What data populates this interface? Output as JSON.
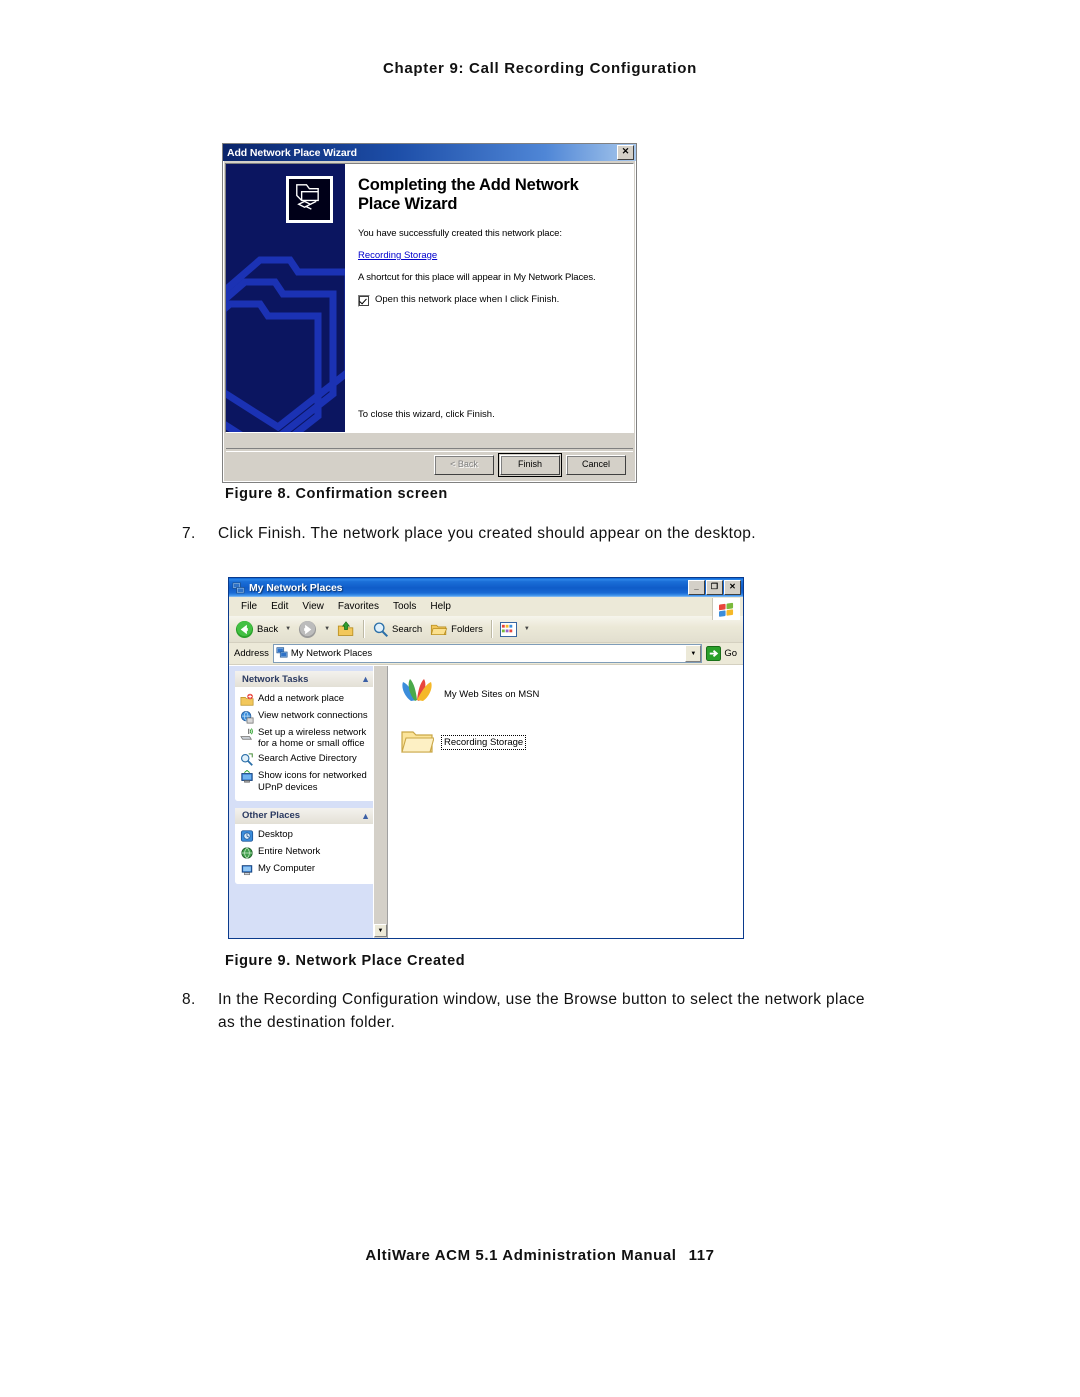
{
  "page": {
    "header": "Chapter 9:  Call Recording Configuration",
    "footer_text": "AltiWare ACM 5.1 Administration Manual",
    "footer_page": "117"
  },
  "figure8": {
    "caption": "Figure 8.   Confirmation screen"
  },
  "figure9": {
    "caption": "Figure 9.   Network Place Created"
  },
  "steps": [
    {
      "number": "7.",
      "text": "Click Finish. The network place you created should appear on the desktop."
    },
    {
      "number": "8.",
      "text": "In the Recording Configuration window, use the Browse button to select the network place as the destination folder."
    }
  ],
  "wizard": {
    "title": "Add Network Place Wizard",
    "close_label": "✕",
    "heading": "Completing the Add Network Place Wizard",
    "intro": "You have successfully created this network place:",
    "place_link": "Recording Storage",
    "shortcut_note": "A shortcut for this place will appear in My Network Places.",
    "checkbox_label": "Open this network place when I click Finish.",
    "checkbox_checked": true,
    "closing_note": "To close this wizard, click Finish.",
    "buttons": [
      {
        "label": "< Back",
        "state": "disabled"
      },
      {
        "label": "Finish",
        "state": "default"
      },
      {
        "label": "Cancel",
        "state": "normal"
      }
    ],
    "titlebar_color": "#0a246a",
    "sidepanel_color": "#0b1560"
  },
  "explorer": {
    "title": "My Network Places",
    "window_buttons": [
      {
        "name": "minimize",
        "label": "_"
      },
      {
        "name": "maximize",
        "label": "❐"
      },
      {
        "name": "close",
        "label": "✕"
      }
    ],
    "menus": [
      "File",
      "Edit",
      "View",
      "Favorites",
      "Tools",
      "Help"
    ],
    "toolbar": {
      "back": "Back",
      "search": "Search",
      "folders": "Folders"
    },
    "address": {
      "label": "Address",
      "value": "My Network Places",
      "go_label": "Go"
    },
    "task_panels": [
      {
        "title": "Network Tasks",
        "items": [
          {
            "icon": "add-network-place-icon",
            "label": "Add a network place"
          },
          {
            "icon": "view-network-connections-icon",
            "label": "View network connections"
          },
          {
            "icon": "wireless-network-icon",
            "label": "Set up a wireless network for a home or small office"
          },
          {
            "icon": "search-active-directory-icon",
            "label": "Search Active Directory"
          },
          {
            "icon": "upnp-devices-icon",
            "label": "Show icons for networked UPnP devices"
          }
        ]
      },
      {
        "title": "Other Places",
        "items": [
          {
            "icon": "desktop-icon",
            "label": "Desktop"
          },
          {
            "icon": "entire-network-icon",
            "label": "Entire Network"
          },
          {
            "icon": "my-computer-icon",
            "label": "My Computer"
          }
        ]
      }
    ],
    "content_items": [
      {
        "icon": "msn-butterfly-icon",
        "label": "My Web Sites on MSN",
        "selected": false
      },
      {
        "icon": "folder-icon",
        "label": "Recording Storage",
        "selected": true
      }
    ],
    "titlebar_color": "#0a63d6",
    "taskpane_color": "#d6dff7"
  }
}
